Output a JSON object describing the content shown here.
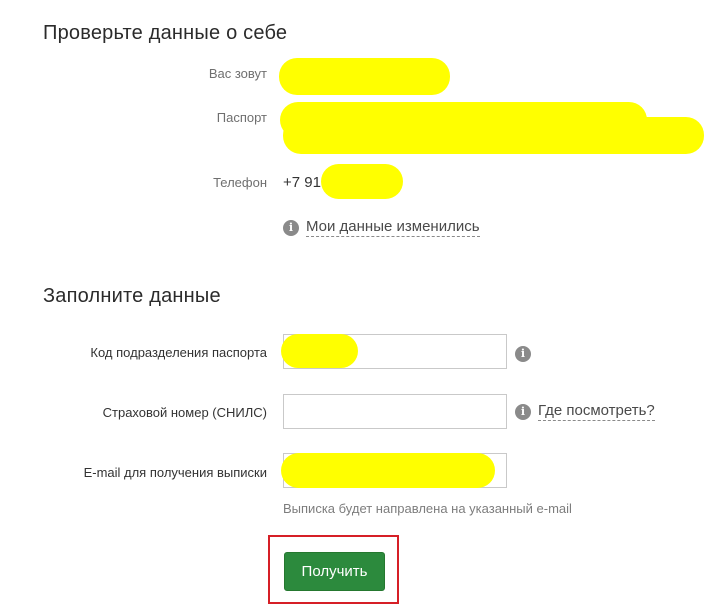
{
  "section_check": {
    "title": "Проверьте данные о себе",
    "name_label": "Вас зовут",
    "passport_label": "Паспорт",
    "phone_label": "Телефон",
    "phone_value": "+7 91",
    "changed_link": "Мои данные изменились"
  },
  "section_fill": {
    "title": "Заполните данные",
    "division_code_label": "Код подразделения паспорта",
    "snils_label": "Страховой номер (СНИЛС)",
    "snils_link": "Где посмотреть?",
    "email_label": "E-mail для получения выписки",
    "email_hint": "Выписка будет направлена на указанный e-mail"
  },
  "actions": {
    "submit_label": "Получить"
  },
  "icons": {
    "info_glyph": "i"
  },
  "colors": {
    "redaction": "#ffff00",
    "button": "#2c8a3d",
    "highlight_border": "#d61f26"
  }
}
